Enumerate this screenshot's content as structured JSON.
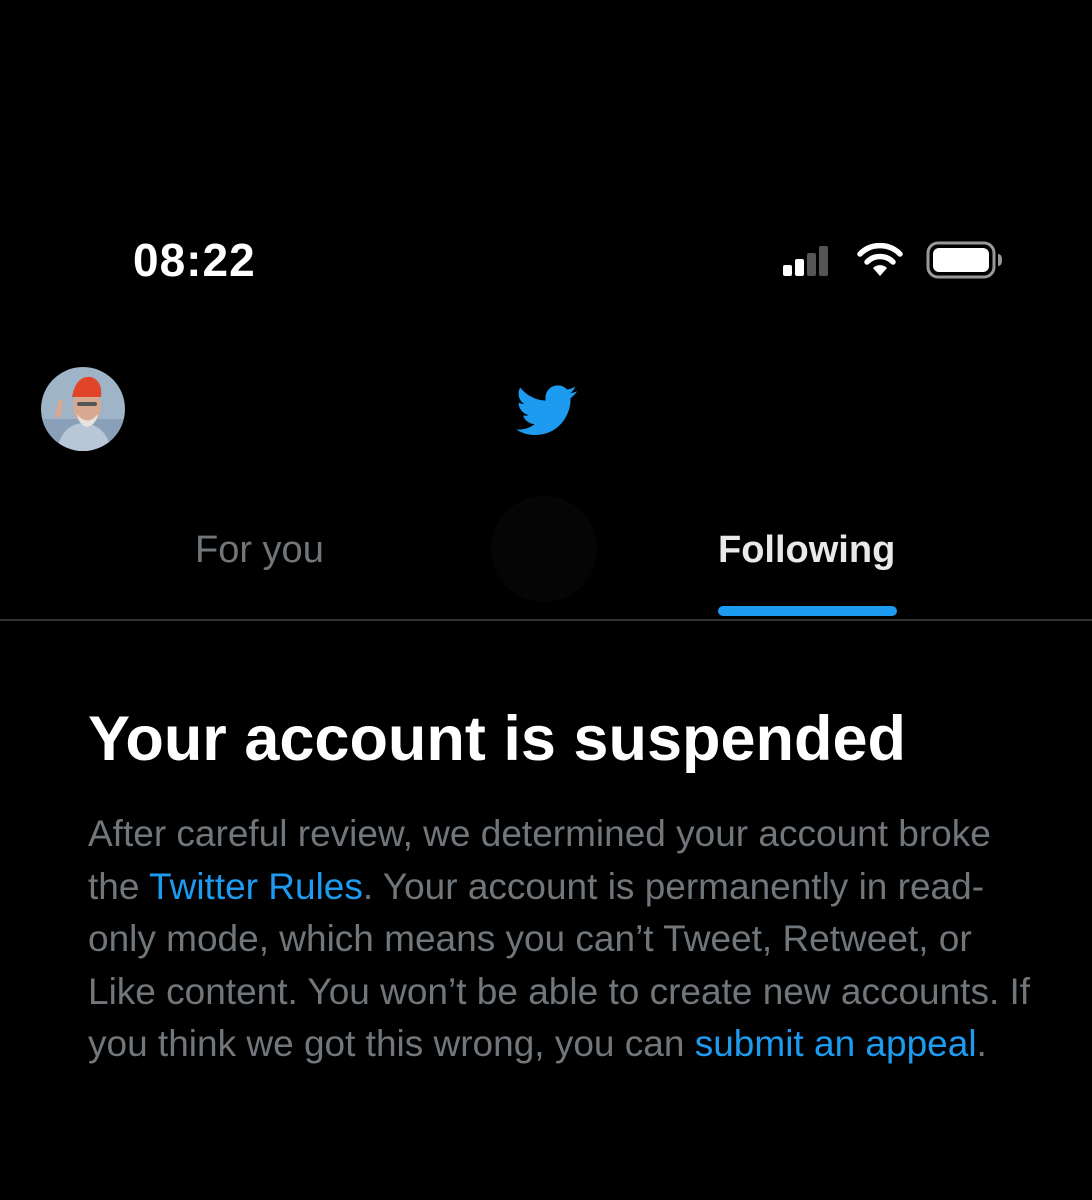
{
  "status_bar": {
    "time": "08:22",
    "icons": [
      "cellular-signal-icon",
      "wifi-icon",
      "battery-icon"
    ]
  },
  "header": {
    "avatar": "profile-avatar",
    "logo": "twitter-bird-icon"
  },
  "tabs": [
    {
      "label": "For you",
      "active": false
    },
    {
      "label": "Following",
      "active": true
    }
  ],
  "colors": {
    "background": "#000000",
    "accent": "#1d9bf0",
    "muted_text": "#71767b",
    "primary_text": "#ffffff"
  },
  "suspension": {
    "title": "Your account is suspended",
    "body_part1": "After careful review, we determined your account broke the ",
    "rules_link": "Twitter Rules",
    "body_part2": ". Your account is permanently in read-only mode, which means you can’t Tweet, Retweet, or Like content. You won’t be able to create new accounts. If you think we got this wrong, you can ",
    "appeal_link": "submit an appeal",
    "body_part3": "."
  }
}
